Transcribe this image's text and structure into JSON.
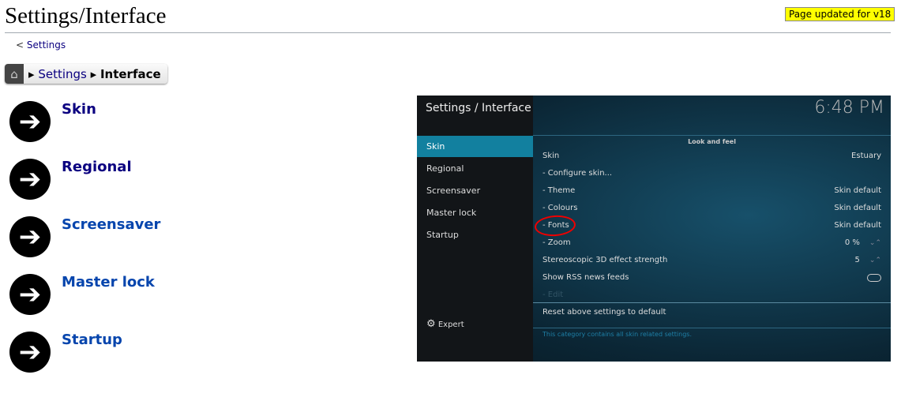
{
  "page": {
    "title": "Settings/Interface",
    "badge": "Page updated for v18",
    "back_link": "Settings",
    "back_prefix": "<"
  },
  "breadcrumb": {
    "home_icon": "home-icon",
    "items": [
      "Settings",
      "Interface"
    ],
    "separator": "▸"
  },
  "links": [
    {
      "label": "Skin",
      "visited": true
    },
    {
      "label": "Regional",
      "visited": true
    },
    {
      "label": "Screensaver",
      "visited": false
    },
    {
      "label": "Master lock",
      "visited": false
    },
    {
      "label": "Startup",
      "visited": false
    }
  ],
  "kodi": {
    "title": "Settings / Interface",
    "clock": "6:48 PM",
    "sidebar": [
      "Skin",
      "Regional",
      "Screensaver",
      "Master lock",
      "Startup"
    ],
    "expert": "Expert",
    "section": "Look and feel",
    "rows": [
      {
        "label": "Skin",
        "value": "Estuary"
      },
      {
        "label": "- Configure skin...",
        "value": ""
      },
      {
        "label": "- Theme",
        "value": "Skin default"
      },
      {
        "label": "- Colours",
        "value": "Skin default"
      },
      {
        "label": "- Fonts",
        "value": "Skin default"
      },
      {
        "label": "- Zoom",
        "value": "0 %"
      },
      {
        "label": "Stereoscopic 3D effect strength",
        "value": "5"
      },
      {
        "label": "Show RSS news feeds",
        "value": ""
      },
      {
        "label": "- Edit",
        "value": ""
      }
    ],
    "reset": "Reset above settings to default",
    "help": "This category contains all skin related settings.",
    "accent": "#12809f",
    "annotation_color": "#e00000"
  }
}
